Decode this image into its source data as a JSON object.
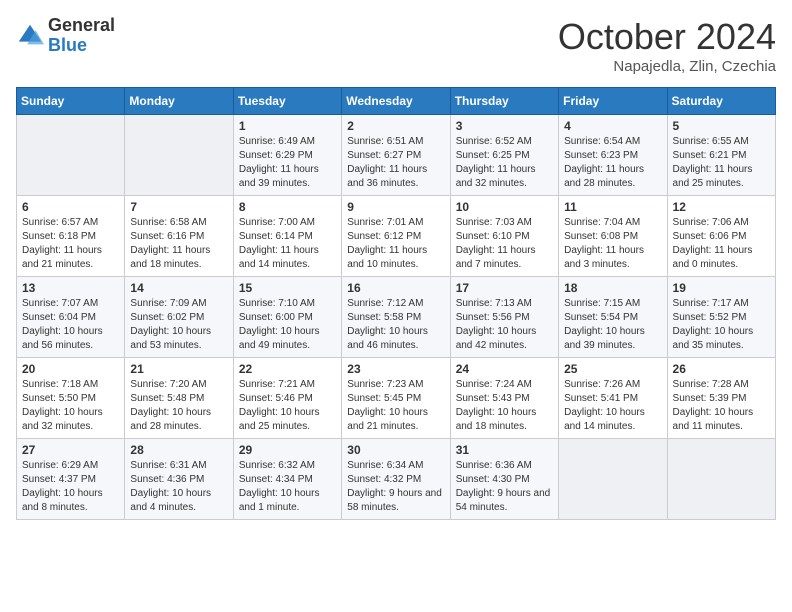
{
  "logo": {
    "general": "General",
    "blue": "Blue"
  },
  "title": "October 2024",
  "subtitle": "Napajedla, Zlin, Czechia",
  "days_of_week": [
    "Sunday",
    "Monday",
    "Tuesday",
    "Wednesday",
    "Thursday",
    "Friday",
    "Saturday"
  ],
  "weeks": [
    [
      {
        "day": "",
        "info": ""
      },
      {
        "day": "",
        "info": ""
      },
      {
        "day": "1",
        "info": "Sunrise: 6:49 AM\nSunset: 6:29 PM\nDaylight: 11 hours and 39 minutes."
      },
      {
        "day": "2",
        "info": "Sunrise: 6:51 AM\nSunset: 6:27 PM\nDaylight: 11 hours and 36 minutes."
      },
      {
        "day": "3",
        "info": "Sunrise: 6:52 AM\nSunset: 6:25 PM\nDaylight: 11 hours and 32 minutes."
      },
      {
        "day": "4",
        "info": "Sunrise: 6:54 AM\nSunset: 6:23 PM\nDaylight: 11 hours and 28 minutes."
      },
      {
        "day": "5",
        "info": "Sunrise: 6:55 AM\nSunset: 6:21 PM\nDaylight: 11 hours and 25 minutes."
      }
    ],
    [
      {
        "day": "6",
        "info": "Sunrise: 6:57 AM\nSunset: 6:18 PM\nDaylight: 11 hours and 21 minutes."
      },
      {
        "day": "7",
        "info": "Sunrise: 6:58 AM\nSunset: 6:16 PM\nDaylight: 11 hours and 18 minutes."
      },
      {
        "day": "8",
        "info": "Sunrise: 7:00 AM\nSunset: 6:14 PM\nDaylight: 11 hours and 14 minutes."
      },
      {
        "day": "9",
        "info": "Sunrise: 7:01 AM\nSunset: 6:12 PM\nDaylight: 11 hours and 10 minutes."
      },
      {
        "day": "10",
        "info": "Sunrise: 7:03 AM\nSunset: 6:10 PM\nDaylight: 11 hours and 7 minutes."
      },
      {
        "day": "11",
        "info": "Sunrise: 7:04 AM\nSunset: 6:08 PM\nDaylight: 11 hours and 3 minutes."
      },
      {
        "day": "12",
        "info": "Sunrise: 7:06 AM\nSunset: 6:06 PM\nDaylight: 11 hours and 0 minutes."
      }
    ],
    [
      {
        "day": "13",
        "info": "Sunrise: 7:07 AM\nSunset: 6:04 PM\nDaylight: 10 hours and 56 minutes."
      },
      {
        "day": "14",
        "info": "Sunrise: 7:09 AM\nSunset: 6:02 PM\nDaylight: 10 hours and 53 minutes."
      },
      {
        "day": "15",
        "info": "Sunrise: 7:10 AM\nSunset: 6:00 PM\nDaylight: 10 hours and 49 minutes."
      },
      {
        "day": "16",
        "info": "Sunrise: 7:12 AM\nSunset: 5:58 PM\nDaylight: 10 hours and 46 minutes."
      },
      {
        "day": "17",
        "info": "Sunrise: 7:13 AM\nSunset: 5:56 PM\nDaylight: 10 hours and 42 minutes."
      },
      {
        "day": "18",
        "info": "Sunrise: 7:15 AM\nSunset: 5:54 PM\nDaylight: 10 hours and 39 minutes."
      },
      {
        "day": "19",
        "info": "Sunrise: 7:17 AM\nSunset: 5:52 PM\nDaylight: 10 hours and 35 minutes."
      }
    ],
    [
      {
        "day": "20",
        "info": "Sunrise: 7:18 AM\nSunset: 5:50 PM\nDaylight: 10 hours and 32 minutes."
      },
      {
        "day": "21",
        "info": "Sunrise: 7:20 AM\nSunset: 5:48 PM\nDaylight: 10 hours and 28 minutes."
      },
      {
        "day": "22",
        "info": "Sunrise: 7:21 AM\nSunset: 5:46 PM\nDaylight: 10 hours and 25 minutes."
      },
      {
        "day": "23",
        "info": "Sunrise: 7:23 AM\nSunset: 5:45 PM\nDaylight: 10 hours and 21 minutes."
      },
      {
        "day": "24",
        "info": "Sunrise: 7:24 AM\nSunset: 5:43 PM\nDaylight: 10 hours and 18 minutes."
      },
      {
        "day": "25",
        "info": "Sunrise: 7:26 AM\nSunset: 5:41 PM\nDaylight: 10 hours and 14 minutes."
      },
      {
        "day": "26",
        "info": "Sunrise: 7:28 AM\nSunset: 5:39 PM\nDaylight: 10 hours and 11 minutes."
      }
    ],
    [
      {
        "day": "27",
        "info": "Sunrise: 6:29 AM\nSunset: 4:37 PM\nDaylight: 10 hours and 8 minutes."
      },
      {
        "day": "28",
        "info": "Sunrise: 6:31 AM\nSunset: 4:36 PM\nDaylight: 10 hours and 4 minutes."
      },
      {
        "day": "29",
        "info": "Sunrise: 6:32 AM\nSunset: 4:34 PM\nDaylight: 10 hours and 1 minute."
      },
      {
        "day": "30",
        "info": "Sunrise: 6:34 AM\nSunset: 4:32 PM\nDaylight: 9 hours and 58 minutes."
      },
      {
        "day": "31",
        "info": "Sunrise: 6:36 AM\nSunset: 4:30 PM\nDaylight: 9 hours and 54 minutes."
      },
      {
        "day": "",
        "info": ""
      },
      {
        "day": "",
        "info": ""
      }
    ]
  ]
}
